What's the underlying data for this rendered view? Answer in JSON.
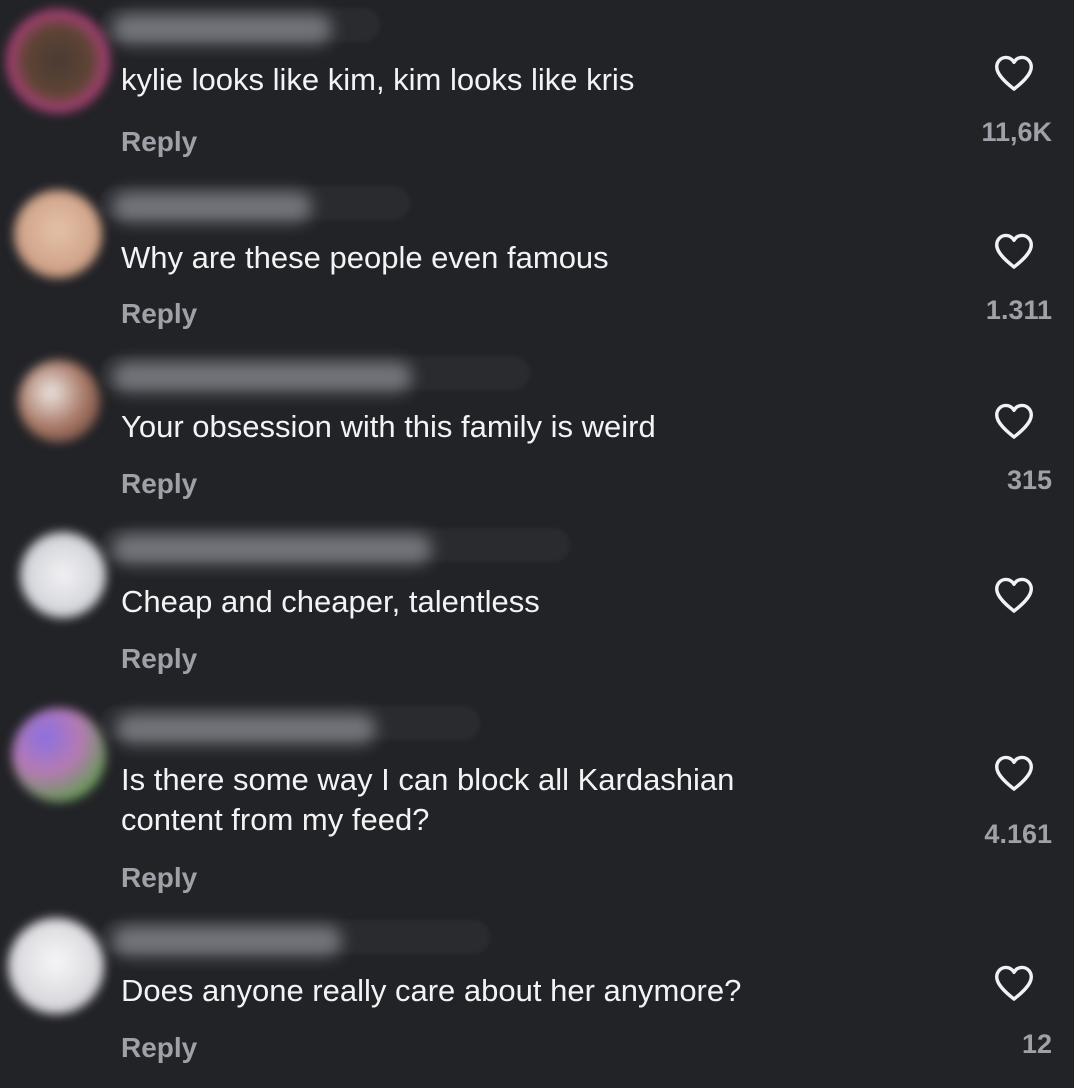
{
  "comments": [
    {
      "text": "kylie looks like kim, kim looks like kris",
      "reply_label": "Reply",
      "likes": "11,6K",
      "avatar_colors": [
        "#5b4a3a",
        "#c23a8a",
        "#e0a040"
      ]
    },
    {
      "text": "Why are these people even famous",
      "reply_label": "Reply",
      "likes": "1.311",
      "avatar_colors": [
        "#d9b39a",
        "#c49a82",
        "#e8c8b0"
      ]
    },
    {
      "text": "Your obsession with this family is weird",
      "reply_label": "Reply",
      "likes": "315",
      "avatar_colors": [
        "#e6e1de",
        "#9a6a58",
        "#5a3a32"
      ]
    },
    {
      "text": "Cheap and cheaper, talentless",
      "reply_label": "Reply",
      "likes": "",
      "avatar_colors": [
        "#e8e9ee",
        "#c8c9d0",
        "#f4f4f6"
      ]
    },
    {
      "text": "Is there some way I can block all Kardashian\ncontent from my feed?",
      "reply_label": "Reply",
      "likes": "4.161",
      "avatar_colors": [
        "#7a6ad8",
        "#c07ab0",
        "#5aa050"
      ]
    },
    {
      "text": "Does anyone really care about her anymore?",
      "reply_label": "Reply",
      "likes": "12",
      "avatar_colors": [
        "#ececee",
        "#d0d0d4",
        "#f8f8f8"
      ]
    }
  ],
  "icons": {
    "like": "heart-outline-icon",
    "avatar": "blurred-avatar"
  },
  "colors": {
    "background": "#222327",
    "text": "#f3f3f5",
    "secondary_text": "#a0a1a8"
  }
}
